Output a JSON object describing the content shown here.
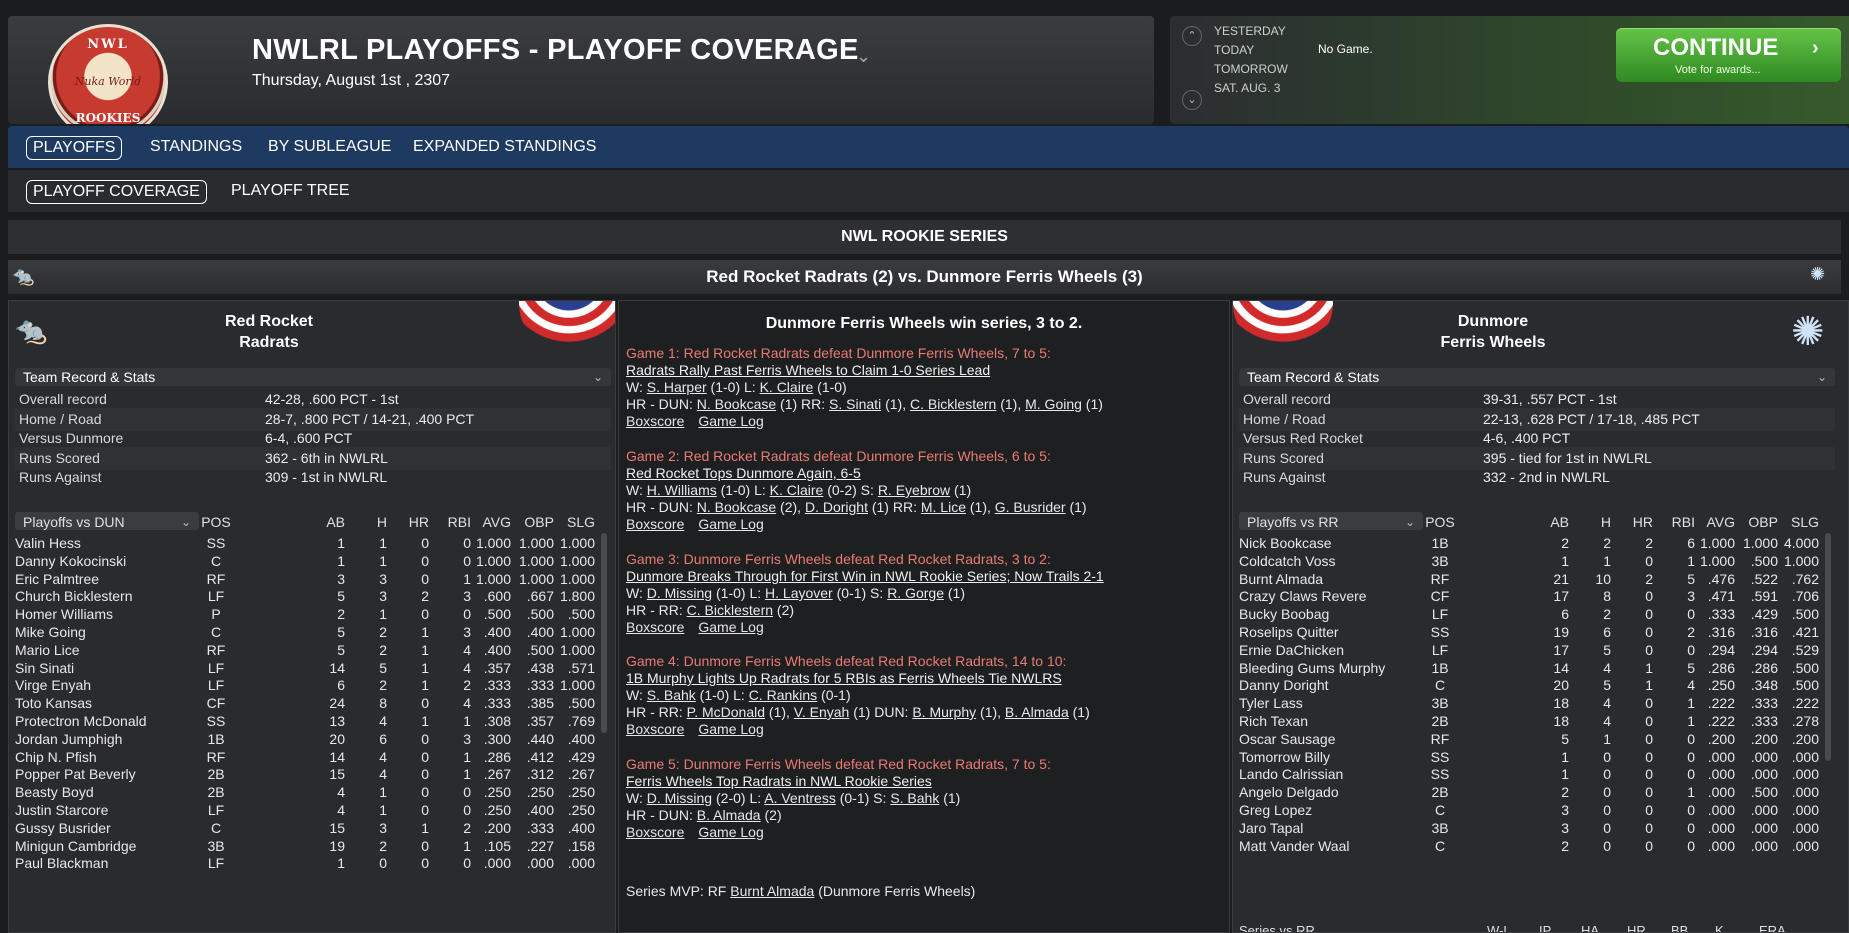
{
  "header": {
    "logo_top": "NWL",
    "logo_mid": "Nuka World",
    "logo_bottom": "ROOKIES",
    "title": "NWLRL PLAYOFFS - PLAYOFF COVERAGE",
    "date": "Thursday, August 1st , 2307"
  },
  "datebox": {
    "yesterday": "YESTERDAY",
    "today": "TODAY",
    "tomorrow": "TOMORROW",
    "next": "SAT. AUG. 3",
    "today_value": "No Game.",
    "continue_label": "CONTINUE",
    "continue_sub": "Vote for awards..."
  },
  "nav": {
    "tabs": [
      "PLAYOFFS",
      "STANDINGS",
      "BY SUBLEAGUE",
      "EXPANDED STANDINGS"
    ],
    "subtabs": [
      "PLAYOFF COVERAGE",
      "PLAYOFF TREE"
    ]
  },
  "series": {
    "title": "NWL ROOKIE SERIES",
    "matchup": "Red Rocket Radrats (2) vs. Dunmore Ferris Wheels (3)",
    "result": "Dunmore Ferris Wheels win series, 3 to 2."
  },
  "left": {
    "name_line1": "Red Rocket",
    "name_line2": "Radrats",
    "section": "Team Record & Stats",
    "record": [
      {
        "k": "Overall record",
        "v": "42-28, .600 PCT - 1st"
      },
      {
        "k": "Home / Road",
        "v": "28-7, .800 PCT / 14-21, .400 PCT"
      },
      {
        "k": "Versus Dunmore",
        "v": "6-4, .600 PCT"
      },
      {
        "k": "Runs Scored",
        "v": "362 - 6th in NWLRL"
      },
      {
        "k": "Runs Against",
        "v": "309 - 1st in NWLRL"
      }
    ],
    "table_select": "Playoffs vs DUN",
    "columns": [
      "POS",
      "AB",
      "H",
      "HR",
      "RBI",
      "AVG",
      "OBP",
      "SLG"
    ],
    "players": [
      [
        "Valin Hess",
        "SS",
        "1",
        "1",
        "0",
        "0",
        "1.000",
        "1.000",
        "1.000"
      ],
      [
        "Danny Kokocinski",
        "C",
        "1",
        "1",
        "0",
        "0",
        "1.000",
        "1.000",
        "1.000"
      ],
      [
        "Eric Palmtree",
        "RF",
        "3",
        "3",
        "0",
        "1",
        "1.000",
        "1.000",
        "1.000"
      ],
      [
        "Church Bicklestern",
        "LF",
        "5",
        "3",
        "2",
        "3",
        ".600",
        ".667",
        "1.800"
      ],
      [
        "Homer Williams",
        "P",
        "2",
        "1",
        "0",
        "0",
        ".500",
        ".500",
        ".500"
      ],
      [
        "Mike Going",
        "C",
        "5",
        "2",
        "1",
        "3",
        ".400",
        ".400",
        "1.000"
      ],
      [
        "Mario Lice",
        "RF",
        "5",
        "2",
        "1",
        "4",
        ".400",
        ".500",
        "1.000"
      ],
      [
        "Sin Sinati",
        "LF",
        "14",
        "5",
        "1",
        "4",
        ".357",
        ".438",
        ".571"
      ],
      [
        "Virge Enyah",
        "LF",
        "6",
        "2",
        "1",
        "2",
        ".333",
        ".333",
        "1.000"
      ],
      [
        "Toto Kansas",
        "CF",
        "24",
        "8",
        "0",
        "4",
        ".333",
        ".385",
        ".500"
      ],
      [
        "Protectron McDonald",
        "SS",
        "13",
        "4",
        "1",
        "1",
        ".308",
        ".357",
        ".769"
      ],
      [
        "Jordan Jumphigh",
        "1B",
        "20",
        "6",
        "0",
        "3",
        ".300",
        ".440",
        ".400"
      ],
      [
        "Chip N. Pfish",
        "RF",
        "14",
        "4",
        "0",
        "1",
        ".286",
        ".412",
        ".429"
      ],
      [
        "Popper Pat Beverly",
        "2B",
        "15",
        "4",
        "0",
        "1",
        ".267",
        ".312",
        ".267"
      ],
      [
        "Beasty Boyd",
        "2B",
        "4",
        "1",
        "0",
        "0",
        ".250",
        ".250",
        ".250"
      ],
      [
        "Justin Starcore",
        "LF",
        "4",
        "1",
        "0",
        "0",
        ".250",
        ".400",
        ".250"
      ],
      [
        "Gussy Busrider",
        "C",
        "15",
        "3",
        "1",
        "2",
        ".200",
        ".333",
        ".400"
      ],
      [
        "Minigun Cambridge",
        "3B",
        "19",
        "2",
        "0",
        "1",
        ".105",
        ".227",
        ".158"
      ],
      [
        "Paul Blackman",
        "LF",
        "1",
        "0",
        "0",
        "0",
        ".000",
        ".000",
        ".000"
      ]
    ]
  },
  "right": {
    "name_line1": "Dunmore",
    "name_line2": "Ferris Wheels",
    "section": "Team Record & Stats",
    "record": [
      {
        "k": "Overall record",
        "v": "39-31, .557 PCT - 1st"
      },
      {
        "k": "Home / Road",
        "v": "22-13, .628 PCT / 17-18, .485 PCT"
      },
      {
        "k": "Versus Red Rocket",
        "v": "4-6, .400 PCT"
      },
      {
        "k": "Runs Scored",
        "v": "395 - tied for 1st in NWLRL"
      },
      {
        "k": "Runs Against",
        "v": "332 - 2nd in NWLRL"
      }
    ],
    "table_select": "Playoffs vs RR",
    "columns": [
      "POS",
      "AB",
      "H",
      "HR",
      "RBI",
      "AVG",
      "OBP",
      "SLG"
    ],
    "players": [
      [
        "Nick Bookcase",
        "1B",
        "2",
        "2",
        "2",
        "6",
        "1.000",
        "1.000",
        "4.000"
      ],
      [
        "Coldcatch Voss",
        "3B",
        "1",
        "1",
        "0",
        "1",
        "1.000",
        ".500",
        "1.000"
      ],
      [
        "Burnt Almada",
        "RF",
        "21",
        "10",
        "2",
        "5",
        ".476",
        ".522",
        ".762"
      ],
      [
        "Crazy Claws Revere",
        "CF",
        "17",
        "8",
        "0",
        "3",
        ".471",
        ".591",
        ".706"
      ],
      [
        "Bucky Boobag",
        "LF",
        "6",
        "2",
        "0",
        "0",
        ".333",
        ".429",
        ".500"
      ],
      [
        "Roselips Quitter",
        "SS",
        "19",
        "6",
        "0",
        "2",
        ".316",
        ".316",
        ".421"
      ],
      [
        "Ernie DaChicken",
        "LF",
        "17",
        "5",
        "0",
        "0",
        ".294",
        ".294",
        ".529"
      ],
      [
        "Bleeding Gums Murphy",
        "1B",
        "14",
        "4",
        "1",
        "5",
        ".286",
        ".286",
        ".500"
      ],
      [
        "Danny Doright",
        "C",
        "20",
        "5",
        "1",
        "4",
        ".250",
        ".348",
        ".500"
      ],
      [
        "Tyler Lass",
        "3B",
        "18",
        "4",
        "0",
        "1",
        ".222",
        ".333",
        ".222"
      ],
      [
        "Rich Texan",
        "2B",
        "18",
        "4",
        "0",
        "1",
        ".222",
        ".333",
        ".278"
      ],
      [
        "Oscar Sausage",
        "RF",
        "5",
        "1",
        "0",
        "0",
        ".200",
        ".200",
        ".200"
      ],
      [
        "Tomorrow Billy",
        "SS",
        "1",
        "0",
        "0",
        "0",
        ".000",
        ".000",
        ".000"
      ],
      [
        "Lando Calrissian",
        "SS",
        "1",
        "0",
        "0",
        "0",
        ".000",
        ".000",
        ".000"
      ],
      [
        "Angelo Delgado",
        "2B",
        "2",
        "0",
        "0",
        "1",
        ".000",
        ".500",
        ".000"
      ],
      [
        "Greg Lopez",
        "C",
        "3",
        "0",
        "0",
        "0",
        ".000",
        ".000",
        ".000"
      ],
      [
        "Jaro Tapal",
        "3B",
        "3",
        "0",
        "0",
        "0",
        ".000",
        ".000",
        ".000"
      ],
      [
        "Matt Vander Waal",
        "C",
        "2",
        "0",
        "0",
        "0",
        ".000",
        ".000",
        ".000"
      ]
    ],
    "footer_partial": [
      "Series vs RR",
      "W-L",
      "IP",
      "HA",
      "HR",
      "BB",
      "K",
      "ERA"
    ]
  },
  "games": [
    {
      "title": "Game 1: Red Rocket Radrats defeat Dunmore Ferris Wheels, 7 to 5:",
      "headline": "Radrats Rally Past Ferris Wheels to Claim 1-0 Series Lead",
      "pitchers": [
        [
          "W: ",
          "S. Harper",
          " (1-0) L: ",
          "K. Claire",
          " (1-0)"
        ]
      ],
      "hr": [
        [
          "HR - DUN: ",
          "N. Bookcase",
          " (1)  RR: ",
          "S. Sinati",
          " (1), ",
          "C. Bicklestern",
          " (1), ",
          "M. Going",
          " (1)"
        ]
      ]
    },
    {
      "title": "Game 2: Red Rocket Radrats defeat Dunmore Ferris Wheels, 6 to 5:",
      "headline": "Red Rocket Tops Dunmore Again, 6-5",
      "pitchers": [
        [
          "W: ",
          "H. Williams",
          " (1-0) L: ",
          "K. Claire",
          " (0-2) S: ",
          "R. Eyebrow",
          " (1)"
        ]
      ],
      "hr": [
        [
          "HR - DUN: ",
          "N. Bookcase",
          " (2), ",
          "D. Doright",
          " (1)  RR: ",
          "M. Lice",
          " (1), ",
          "G. Busrider",
          " (1)"
        ]
      ]
    },
    {
      "title": "Game 3: Dunmore Ferris Wheels defeat Red Rocket Radrats, 3 to 2:",
      "headline": "Dunmore Breaks Through for First Win in NWL Rookie Series; Now Trails 2-1",
      "pitchers": [
        [
          "W: ",
          "D. Missing",
          " (1-0) L: ",
          "H. Layover",
          " (0-1) S: ",
          "R. Gorge",
          " (1)"
        ]
      ],
      "hr": [
        [
          "HR - RR: ",
          "C. Bicklestern",
          " (2)"
        ]
      ]
    },
    {
      "title": "Game 4: Dunmore Ferris Wheels defeat Red Rocket Radrats, 14 to 10:",
      "headline": "1B Murphy Lights Up Radrats for 5 RBIs as Ferris Wheels Tie NWLRS",
      "pitchers": [
        [
          "W: ",
          "S. Bahk",
          " (1-0) L: ",
          "C. Rankins",
          " (0-1)"
        ]
      ],
      "hr": [
        [
          "HR - RR: ",
          "P. McDonald",
          " (1), ",
          "V. Enyah",
          " (1)  DUN: ",
          "B. Murphy",
          " (1), ",
          "B. Almada",
          " (1)"
        ]
      ]
    },
    {
      "title": "Game 5: Dunmore Ferris Wheels defeat Red Rocket Radrats, 7 to 5:",
      "headline": "Ferris Wheels Top Radrats in NWL Rookie Series",
      "pitchers": [
        [
          "W: ",
          "D. Missing",
          " (2-0) L: ",
          "A. Ventress",
          " (0-1) S: ",
          "S. Bahk",
          " (1)"
        ]
      ],
      "hr": [
        [
          "HR - DUN: ",
          "B. Almada",
          " (2)"
        ]
      ]
    }
  ],
  "links": {
    "boxscore": "Boxscore",
    "gamelog": "Game Log"
  },
  "mvp": {
    "prefix": "Series MVP: RF ",
    "name": "Burnt Almada",
    "suffix": " (Dunmore Ferris Wheels)"
  },
  "colors": {
    "game_title": "#e97b73",
    "nav_bg": "#1f3a60",
    "continue_green": "#3fa52e"
  }
}
